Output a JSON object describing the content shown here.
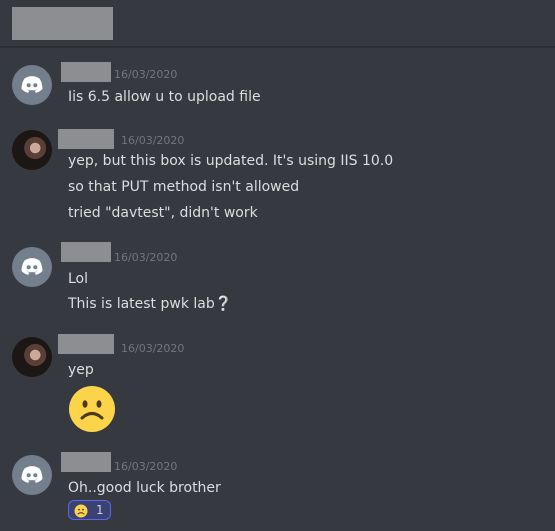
{
  "header": {
    "title_redacted": true
  },
  "messages": [
    {
      "timestamp": "16/03/2020",
      "lines": [
        "Iis 6.5 allow u to upload file"
      ]
    },
    {
      "timestamp": "16/03/2020",
      "lines": [
        "yep, but this box is updated. It's using IIS 10.0",
        "so that PUT method isn't allowed",
        "tried \"davtest\", didn't work"
      ]
    },
    {
      "timestamp": "16/03/2020",
      "lines": [
        "Lol",
        "This is latest pwk lab❔"
      ]
    },
    {
      "timestamp": "16/03/2020",
      "lines": [
        "yep"
      ],
      "emoji": "frowning-face-icon"
    },
    {
      "timestamp": "16/03/2020",
      "lines": [
        "Oh..good luck brother"
      ],
      "reaction": {
        "emoji": "frowning-face-icon",
        "count": "1"
      }
    }
  ],
  "colors": {
    "background": "#36393f",
    "text": "#dcddde",
    "timestamp": "#72767d",
    "discord_avatar": "#747f8d",
    "reaction_bg": "#3c4270",
    "reaction_border": "#5865f2"
  }
}
